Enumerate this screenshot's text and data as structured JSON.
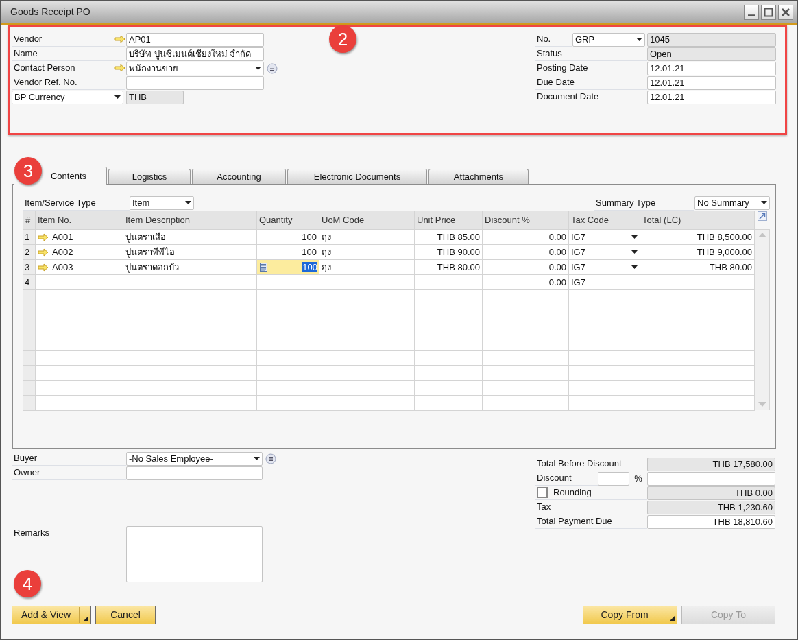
{
  "window": {
    "title": "Goods Receipt PO"
  },
  "header": {
    "highlighted": true,
    "callout": "2",
    "left": [
      {
        "label": "Vendor",
        "kind": "text",
        "value": "AP01",
        "arrow": true
      },
      {
        "label": "Name",
        "kind": "text",
        "value": "บริษัท ปูนซีเมนต์เชียงใหม่ จำกัด",
        "arrow": false
      },
      {
        "label": "Contact Person",
        "kind": "dropdown-list",
        "value": "พนักงานขาย",
        "arrow": true
      },
      {
        "label": "Vendor Ref. No.",
        "kind": "text",
        "arrow": false
      },
      {
        "label": "BP Currency",
        "kind": "label-dropdown",
        "value": "THB"
      }
    ],
    "right": [
      {
        "label": "No.",
        "kind": "series",
        "series": "GRP",
        "value": "1045"
      },
      {
        "label": "Status",
        "kind": "readonly",
        "value": "Open"
      },
      {
        "label": "Posting Date",
        "kind": "text",
        "value": "12.01.21"
      },
      {
        "label": "Due Date",
        "kind": "text",
        "value": "12.01.21"
      },
      {
        "label": "Document Date",
        "kind": "text",
        "value": "12.01.21"
      }
    ]
  },
  "tabs": [
    {
      "label": "Contents",
      "selected": true
    },
    {
      "label": "Logistics",
      "selected": false
    },
    {
      "label": "Accounting",
      "selected": false
    },
    {
      "label": "Electronic Documents",
      "selected": false
    },
    {
      "label": "Attachments",
      "selected": false
    }
  ],
  "contents": {
    "callout": "3",
    "item_type": {
      "label": "Item/Service Type",
      "value": "Item"
    },
    "summary_type": {
      "label": "Summary Type",
      "value": "No Summary"
    },
    "table": {
      "columns": [
        "#",
        "Item No.",
        "Item Description",
        "Quantity",
        "UoM Code",
        "Unit Price",
        "Discount %",
        "Tax Code",
        "Total (LC)"
      ],
      "rows": [
        {
          "number": "1",
          "item_no": "A001",
          "description": "ปูนตราเสือ",
          "quantity": "100",
          "uom": "ถุง",
          "unit_price": "THB 85.00",
          "discount": "0.00",
          "tax_code": "IG7",
          "total": "THB 8,500.00",
          "arrow": true,
          "tax_dropdown": true,
          "quantity_editing": false
        },
        {
          "number": "2",
          "item_no": "A002",
          "description": "ปูนตราทีพีไอ",
          "quantity": "100",
          "uom": "ถุง",
          "unit_price": "THB 90.00",
          "discount": "0.00",
          "tax_code": "IG7",
          "total": "THB 9,000.00",
          "arrow": true,
          "tax_dropdown": true,
          "quantity_editing": false
        },
        {
          "number": "3",
          "item_no": "A003",
          "description": "ปูนตราดอกบัว",
          "quantity": "100",
          "uom": "ถุง",
          "unit_price": "THB 80.00",
          "discount": "0.00",
          "tax_code": "IG7",
          "total": "THB 80.00",
          "arrow": true,
          "tax_dropdown": true,
          "quantity_editing": true
        },
        {
          "number": "4",
          "discount": "0.00",
          "tax_code": "IG7",
          "arrow": false,
          "tax_dropdown": false,
          "quantity_editing": false
        }
      ]
    }
  },
  "footer": {
    "left": [
      {
        "label": "Buyer",
        "kind": "dropdown-list",
        "value": "-No Sales Employee-"
      },
      {
        "label": "Owner",
        "kind": "text"
      },
      {
        "label": "Remarks",
        "kind": "textarea"
      }
    ],
    "totals": [
      {
        "label": "Total Before Discount",
        "kind": "readonly",
        "value": "THB 17,580.00"
      },
      {
        "label": "Discount",
        "kind": "discount",
        "unit": "%"
      },
      {
        "label": "Rounding",
        "kind": "checkbox",
        "checked": false,
        "value": "THB 0.00"
      },
      {
        "label": "Tax",
        "kind": "readonly",
        "value": "THB 1,230.60"
      },
      {
        "label": "Total Payment Due",
        "kind": "text",
        "value": "THB 18,810.60"
      }
    ]
  },
  "buttons": {
    "callout": "4",
    "left": [
      {
        "label": "Add & View",
        "kind": "split",
        "disabled": false
      },
      {
        "label": "Cancel",
        "kind": "plain",
        "disabled": false
      }
    ],
    "right": [
      {
        "label": "Copy From",
        "kind": "split",
        "disabled": false
      },
      {
        "label": "Copy To",
        "kind": "plain",
        "disabled": true
      }
    ]
  }
}
